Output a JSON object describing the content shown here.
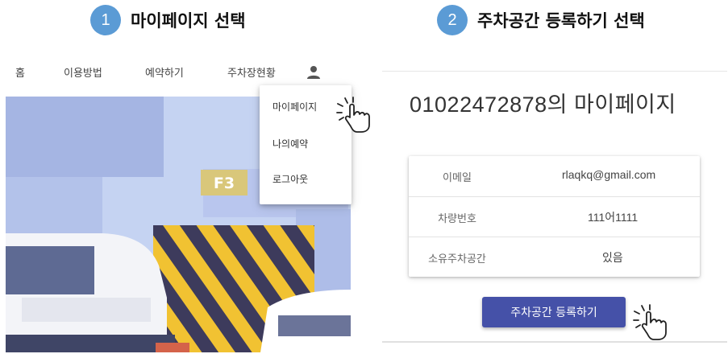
{
  "steps": [
    {
      "number": "1",
      "title": "마이페이지 선택"
    },
    {
      "number": "2",
      "title": "주차공간 등록하기 선택"
    }
  ],
  "nav": {
    "items": [
      {
        "label": "홈"
      },
      {
        "label": "이용방법"
      },
      {
        "label": "예약하기"
      },
      {
        "label": "주차장현황"
      }
    ],
    "user_icon": "user-icon"
  },
  "hero": {
    "sign_text": "F3"
  },
  "dropdown": {
    "items": [
      {
        "label": "마이페이지"
      },
      {
        "label": "나의예약"
      },
      {
        "label": "로그아웃"
      }
    ]
  },
  "mypage": {
    "title": "01022472878의 마이페이지",
    "rows": [
      {
        "label": "이메일",
        "value": "rlaqkq@gmail.com"
      },
      {
        "label": "차량번호",
        "value": "111어1111"
      },
      {
        "label": "소유주차공간",
        "value": "있음"
      }
    ],
    "register_button": "주차공간 등록하기"
  },
  "colors": {
    "step_circle": "#5b9bd5",
    "button": "#4551a8",
    "sky": "#c5d3f2",
    "building": "#a5b5e3",
    "sign": "#d9c77a"
  },
  "icons": [
    "user-icon",
    "hand-pointer-icon"
  ]
}
